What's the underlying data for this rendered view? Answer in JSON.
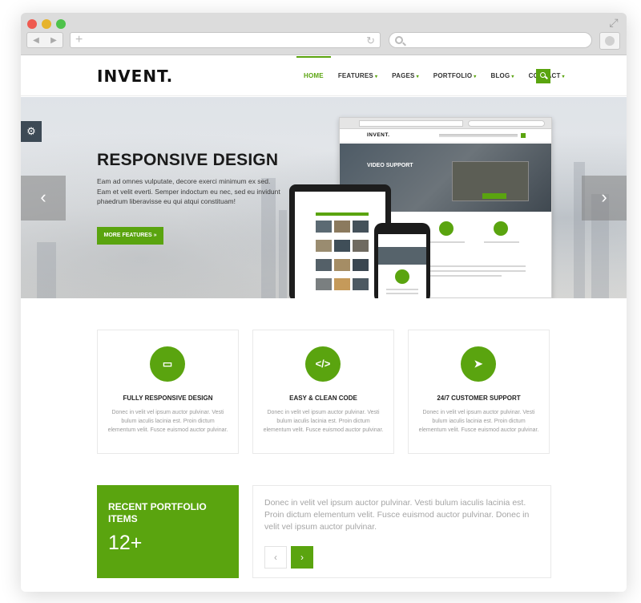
{
  "colors": {
    "accent": "#5aa40f",
    "dark": "#1b1b1b",
    "muted_text": "#9a9a9a",
    "chrome_bg": "#dcdcdc"
  },
  "browser": {
    "icons": {
      "back": "back-arrow-icon",
      "forward": "forward-arrow-icon",
      "new_tab": "plus-icon",
      "reload": "reload-icon",
      "search": "search-icon",
      "expand": "expand-icon"
    }
  },
  "header": {
    "logo": "INVENT.",
    "nav": [
      {
        "label": "HOME",
        "active": true
      },
      {
        "label": "FEATURES",
        "dropdown": true
      },
      {
        "label": "PAGES",
        "dropdown": true
      },
      {
        "label": "PORTFOLIO",
        "dropdown": true
      },
      {
        "label": "BLOG",
        "dropdown": true
      },
      {
        "label": "CONTACT",
        "dropdown": true
      }
    ],
    "search_icon": "search-icon"
  },
  "hero": {
    "title": "RESPONSIVE DESIGN",
    "text": "Eam ad omnes vulputate, decore exerci minimum ex sed. Eam et velit everti. Semper indoctum eu nec, sed eu invidunt phaedrum liberavisse eu qui atqui constituam!",
    "cta": "MORE FEATURES »",
    "prev_icon": "chevron-left-icon",
    "next_icon": "chevron-right-icon",
    "settings_icon": "gear-icon",
    "mockup": {
      "logo": "INVENT.",
      "banner_label": "VIDEO SUPPORT"
    }
  },
  "features": [
    {
      "icon": "laptop-icon",
      "glyph": "▭",
      "title": "FULLY RESPONSIVE DESIGN",
      "desc": "Donec in velit vel ipsum auctor pulvinar. Vesti bulum iaculis lacinia est. Proin dictum elementum velit. Fusce euismod auctor pulvinar."
    },
    {
      "icon": "code-icon",
      "glyph": "</>",
      "title": "EASY & CLEAN CODE",
      "desc": "Donec in velit vel ipsum auctor pulvinar. Vesti bulum iaculis lacinia est. Proin dictum elementum velit. Fusce euismod auctor pulvinar."
    },
    {
      "icon": "paper-plane-icon",
      "glyph": "➤",
      "title": "24/7 CUSTOMER SUPPORT",
      "desc": "Donec in velit vel ipsum auctor pulvinar. Vesti bulum iaculis lacinia est. Proin dictum elementum velit. Fusce euismod auctor pulvinar."
    }
  ],
  "portfolio": {
    "title": "RECENT PORTFOLIO ITEMS",
    "count": "12+",
    "text": "Donec in velit vel ipsum auctor pulvinar. Vesti bulum iaculis lacinia est. Proin dictum elementum velit. Fusce euismod auctor pulvinar. Donec in velit vel ipsum auctor pulvinar.",
    "prev_glyph": "‹",
    "next_glyph": "›"
  }
}
